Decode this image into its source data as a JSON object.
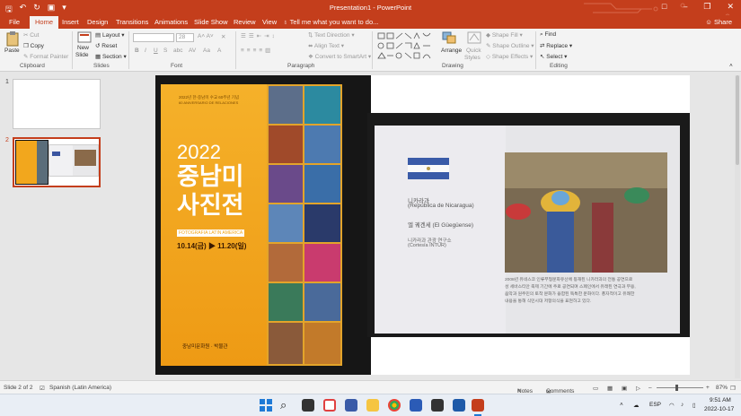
{
  "window": {
    "title": "Presentation1 - PowerPoint"
  },
  "tabs": [
    "File",
    "Home",
    "Insert",
    "Design",
    "Transitions",
    "Animations",
    "Slide Show",
    "Review",
    "View"
  ],
  "active_tab": "Home",
  "tell_me": "Tell me what you want to do...",
  "share": "Share",
  "ribbon": {
    "clipboard": {
      "paste": "Paste",
      "cut": "Cut",
      "copy": "Copy",
      "format_painter": "Format Painter",
      "label": "Clipboard"
    },
    "slides": {
      "new_slide_1": "New",
      "new_slide_2": "Slide",
      "layout": "Layout",
      "reset": "Reset",
      "section": "Section",
      "label": "Slides"
    },
    "font": {
      "size": "28",
      "label": "Font"
    },
    "paragraph": {
      "text_direction": "Text Direction",
      "align_text": "Align Text",
      "convert": "Convert to SmartArt",
      "label": "Paragraph"
    },
    "drawing": {
      "arrange": "Arrange",
      "quick_1": "Quick",
      "quick_2": "Styles",
      "shape_fill": "Shape Fill",
      "shape_outline": "Shape Outline",
      "shape_effects": "Shape Effects",
      "label": "Drawing"
    },
    "editing": {
      "find": "Find",
      "replace": "Replace",
      "select": "Select",
      "label": "Editing"
    }
  },
  "thumbs": {
    "n1": "1",
    "n2": "2"
  },
  "poster": {
    "top_1": "2022년 한-중남미 수교 60주년 기념",
    "top_2": "60 ANIVERSARIO DE RELACIONES",
    "year": "2022",
    "title_1": "중남미",
    "title_2": "사진전",
    "subtitle": "FOTOGRAFIA LATIN AMERICA",
    "dates_a": "10.14(금)",
    "dates_b": "11.20(일)",
    "footer_1": "중남미문화원",
    "footer_2": "박물관"
  },
  "book": {
    "country_ko": "니카라과",
    "country_es": "(República de Nicaragua)",
    "work": "엘 궤겐세 (El Güegüense)",
    "credit_ko": "니카라과 관광 연구소",
    "credit_es": "(Cortesía INTUR)",
    "para_1": "2008년 유네스코 인류무형문화유산에 등재된 니카라과의 전통 공연으로",
    "para_2": "성 세바스티안 축제 기간에 주로 공연되며 스페인에서 유래된 연극과 무용,",
    "para_3": "음악과 원주민의 토착 문화가 융합된 독특한 문화이다. 풍자적이고 유쾌한",
    "para_4": "내용을 통해 식민시대 저항의식을 표현하고 있다."
  },
  "status": {
    "slide": "Slide 2 of 2",
    "language": "Spanish (Latin America)",
    "notes": "Notes",
    "comments": "Comments",
    "zoom": "87%"
  },
  "system": {
    "lang": "ESP",
    "time": "9:51 AM",
    "date": "2022-10-17"
  },
  "colors": {
    "accent": "#c43e1c",
    "poster": "#f2a71d"
  }
}
